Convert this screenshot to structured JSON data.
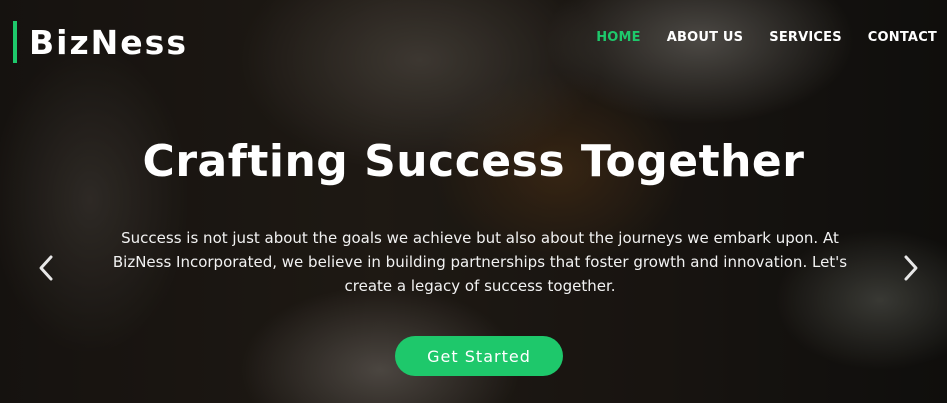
{
  "brand": {
    "name": "BizNess",
    "accent": "#1ec86b"
  },
  "nav": {
    "items": [
      {
        "label": "HOME",
        "active": true
      },
      {
        "label": "ABOUT US",
        "active": false
      },
      {
        "label": "SERVICES",
        "active": false
      },
      {
        "label": "CONTACT",
        "active": false
      }
    ]
  },
  "hero": {
    "headline": "Crafting Success Together",
    "subtext": "Success is not just about the goals we achieve but also about the journeys we embark upon. At BizNess Incorporated, we believe in building partnerships that foster growth and innovation. Let's create a legacy of success together.",
    "cta_label": "Get Started",
    "prev_icon": "chevron-left-icon",
    "next_icon": "chevron-right-icon"
  }
}
